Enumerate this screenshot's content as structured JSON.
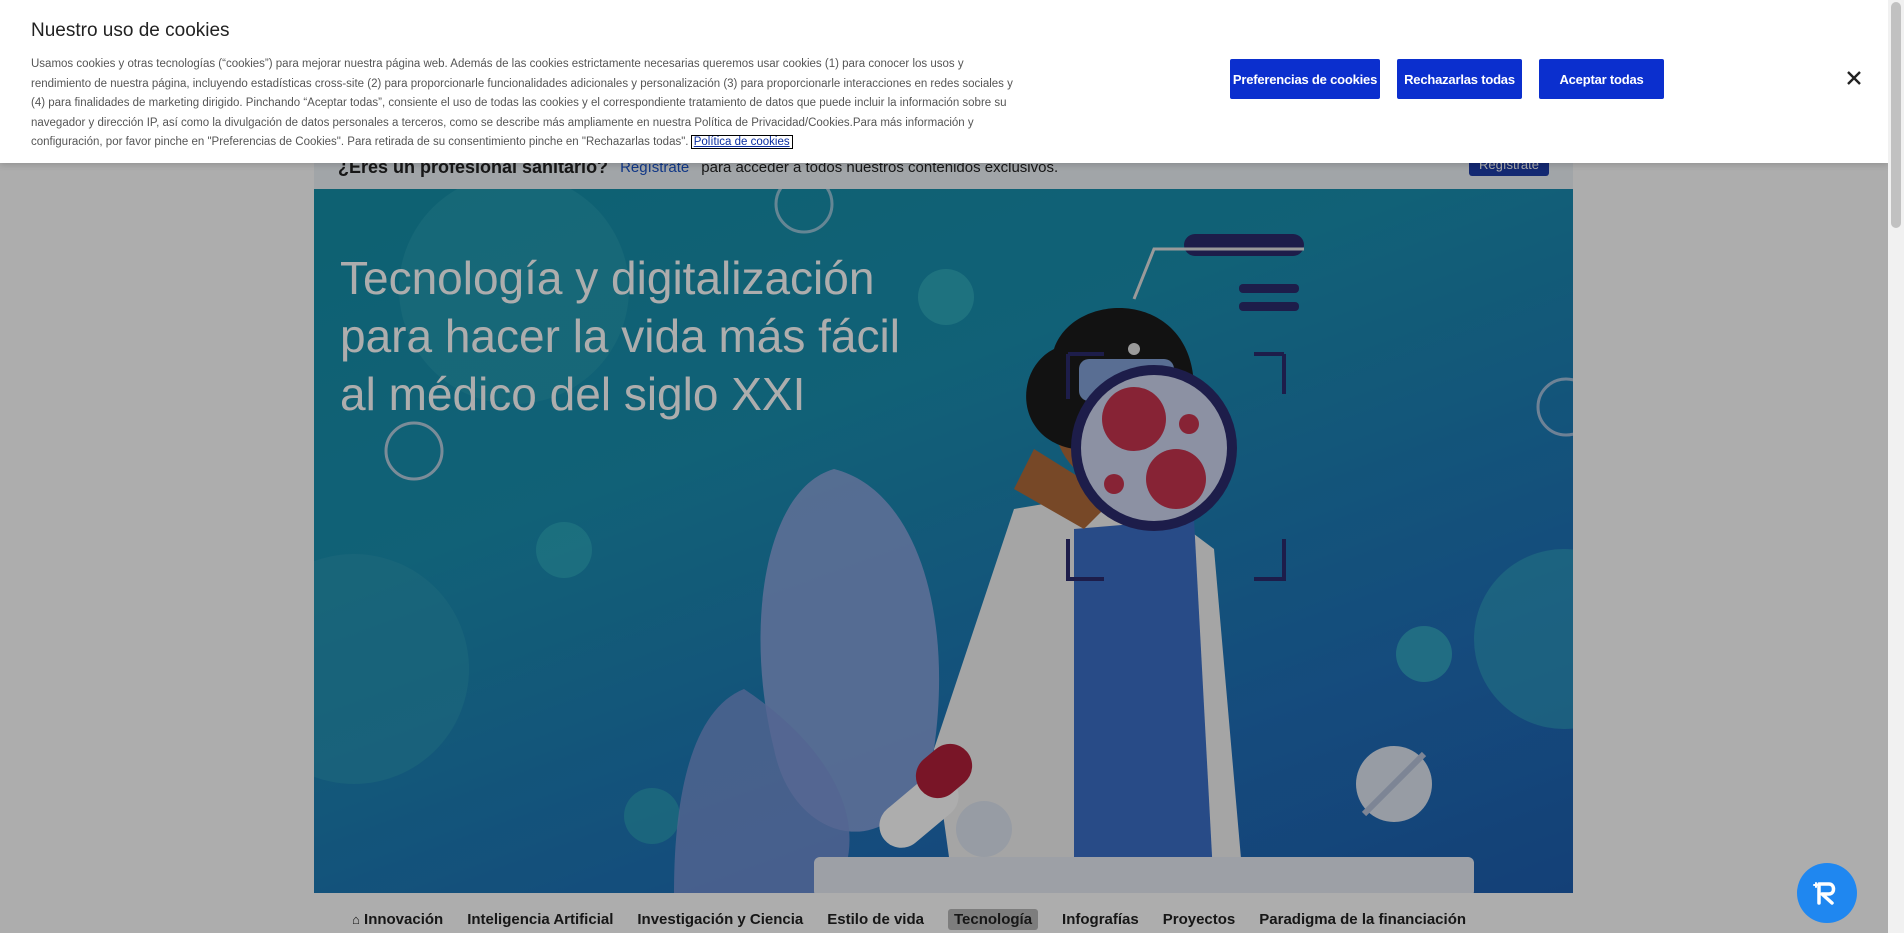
{
  "cookie_banner": {
    "title": "Nuestro uso de cookies",
    "description": "Usamos cookies y otras tecnologías (“cookies”) para mejorar nuestra página web. Además de las cookies estrictamente necesarias queremos usar cookies (1) para conocer los usos y rendimiento de nuestra página, incluyendo estadísticas cross-site (2) para proporcionarle funcionalidades adicionales y personalización (3) para proporcionarle interacciones en redes sociales y (4) para finalidades de marketing dirigido. Pinchando “Aceptar todas”, consiente el uso de todas las cookies y el correspondiente tratamiento de datos que puede incluir la información sobre su navegador y dirección IP, así como la divulgación de datos personales a terceros, como se describe más ampliamente en nuestra Política de Privacidad/Cookies.Para más información y configuración, por favor pinche en \"Preferencias de Cookies\". Para retirada de su consentimiento pinche en \"Rechazarlas todas\".",
    "policy_link": "Política de cookies",
    "buttons": {
      "preferences": "Preferencias de cookies",
      "reject_all": "Rechazarlas todas",
      "accept_all": "Aceptar todas"
    },
    "close_icon": "close-icon"
  },
  "registration_bar": {
    "question": "¿Eres un profesional sanitario?",
    "link": "Regístrate",
    "text": "para acceder a todos nuestros contenidos exclusivos.",
    "button": "Regístrate"
  },
  "hero": {
    "title": "Tecnología y digitalización para hacer la vida más fácil al médico del siglo XXI"
  },
  "nav": {
    "items": [
      {
        "label": "Innovación",
        "icon": "home-icon"
      },
      {
        "label": "Inteligencia Artificial"
      },
      {
        "label": "Investigación y Ciencia"
      },
      {
        "label": "Estilo de vida"
      },
      {
        "label": "Tecnología",
        "active": true
      },
      {
        "label": "Infografías"
      },
      {
        "label": "Proyectos"
      },
      {
        "label": "Paradigma de la financiación"
      }
    ]
  },
  "colors": {
    "button_blue": "#0b2fce",
    "hero_teal": "#1590a8",
    "fab_blue": "#1f87f0"
  }
}
